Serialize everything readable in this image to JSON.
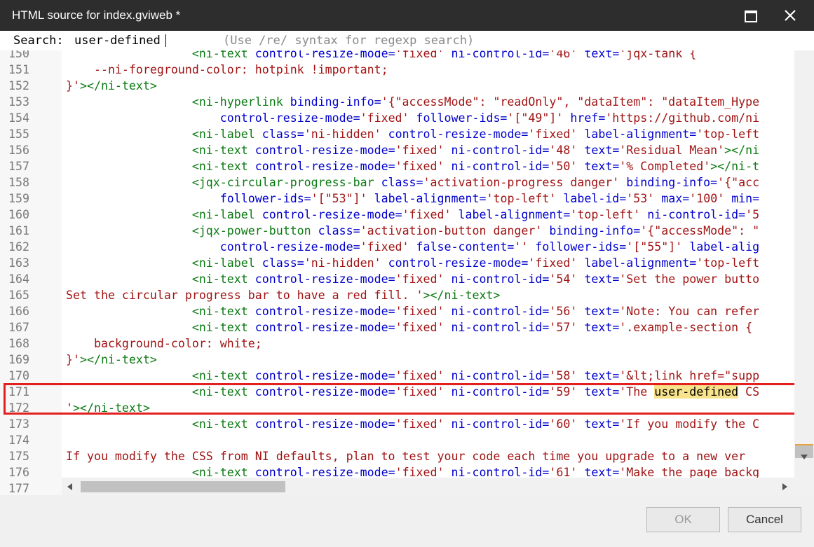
{
  "window": {
    "title": "HTML source for index.gviweb *"
  },
  "search": {
    "label": "Search:",
    "value": "user-defined",
    "hint": "(Use /re/ syntax for regexp search)"
  },
  "editor": {
    "lines": [
      {
        "num": "150",
        "segments": [
          [
            "",
            "                  "
          ],
          [
            "t",
            "<ni-text"
          ],
          [
            "",
            " "
          ],
          [
            "a",
            "control-resize-mode="
          ],
          [
            "v",
            "'fixed'"
          ],
          [
            "",
            " "
          ],
          [
            "a",
            "ni-control-id="
          ],
          [
            "v",
            "'46'"
          ],
          [
            "",
            " "
          ],
          [
            "a",
            "text="
          ],
          [
            "v",
            "'jqx-tank {"
          ]
        ]
      },
      {
        "num": "151",
        "segments": [
          [
            "v",
            "    --ni-foreground-color: hotpink !important;"
          ]
        ]
      },
      {
        "num": "152",
        "segments": [
          [
            "v",
            "}'"
          ],
          [
            "t",
            "></ni-text>"
          ]
        ]
      },
      {
        "num": "153",
        "segments": [
          [
            "",
            "                  "
          ],
          [
            "t",
            "<ni-hyperlink"
          ],
          [
            "",
            " "
          ],
          [
            "a",
            "binding-info="
          ],
          [
            "v",
            "'{\"accessMode\": \"readOnly\", \"dataItem\": \"dataItem_Hype"
          ]
        ]
      },
      {
        "num": "154",
        "segments": [
          [
            "",
            "                      "
          ],
          [
            "a",
            "control-resize-mode="
          ],
          [
            "v",
            "'fixed'"
          ],
          [
            "",
            " "
          ],
          [
            "a",
            "follower-ids="
          ],
          [
            "v",
            "'[\"49\"]'"
          ],
          [
            "",
            " "
          ],
          [
            "a",
            "href="
          ],
          [
            "v",
            "'https://github.com/ni"
          ]
        ]
      },
      {
        "num": "155",
        "segments": [
          [
            "",
            "                  "
          ],
          [
            "t",
            "<ni-label"
          ],
          [
            "",
            " "
          ],
          [
            "a",
            "class="
          ],
          [
            "v",
            "'ni-hidden'"
          ],
          [
            "",
            " "
          ],
          [
            "a",
            "control-resize-mode="
          ],
          [
            "v",
            "'fixed'"
          ],
          [
            "",
            " "
          ],
          [
            "a",
            "label-alignment="
          ],
          [
            "v",
            "'top-left"
          ]
        ]
      },
      {
        "num": "156",
        "segments": [
          [
            "",
            "                  "
          ],
          [
            "t",
            "<ni-text"
          ],
          [
            "",
            " "
          ],
          [
            "a",
            "control-resize-mode="
          ],
          [
            "v",
            "'fixed'"
          ],
          [
            "",
            " "
          ],
          [
            "a",
            "ni-control-id="
          ],
          [
            "v",
            "'48'"
          ],
          [
            "",
            " "
          ],
          [
            "a",
            "text="
          ],
          [
            "v",
            "'Residual Mean'"
          ],
          [
            "t",
            "></ni"
          ]
        ]
      },
      {
        "num": "157",
        "segments": [
          [
            "",
            "                  "
          ],
          [
            "t",
            "<ni-text"
          ],
          [
            "",
            " "
          ],
          [
            "a",
            "control-resize-mode="
          ],
          [
            "v",
            "'fixed'"
          ],
          [
            "",
            " "
          ],
          [
            "a",
            "ni-control-id="
          ],
          [
            "v",
            "'50'"
          ],
          [
            "",
            " "
          ],
          [
            "a",
            "text="
          ],
          [
            "v",
            "'% Completed'"
          ],
          [
            "t",
            "></ni-t"
          ]
        ]
      },
      {
        "num": "158",
        "segments": [
          [
            "",
            "                  "
          ],
          [
            "t",
            "<jqx-circular-progress-bar"
          ],
          [
            "",
            " "
          ],
          [
            "a",
            "class="
          ],
          [
            "v",
            "'activation-progress danger'"
          ],
          [
            "",
            " "
          ],
          [
            "a",
            "binding-info="
          ],
          [
            "v",
            "'{\"acc"
          ]
        ]
      },
      {
        "num": "159",
        "segments": [
          [
            "",
            "                      "
          ],
          [
            "a",
            "follower-ids="
          ],
          [
            "v",
            "'[\"53\"]'"
          ],
          [
            "",
            " "
          ],
          [
            "a",
            "label-alignment="
          ],
          [
            "v",
            "'top-left'"
          ],
          [
            "",
            " "
          ],
          [
            "a",
            "label-id="
          ],
          [
            "v",
            "'53'"
          ],
          [
            "",
            " "
          ],
          [
            "a",
            "max="
          ],
          [
            "v",
            "'100'"
          ],
          [
            "",
            " "
          ],
          [
            "a",
            "min="
          ]
        ]
      },
      {
        "num": "160",
        "segments": [
          [
            "",
            "                  "
          ],
          [
            "t",
            "<ni-label"
          ],
          [
            "",
            " "
          ],
          [
            "a",
            "control-resize-mode="
          ],
          [
            "v",
            "'fixed'"
          ],
          [
            "",
            " "
          ],
          [
            "a",
            "label-alignment="
          ],
          [
            "v",
            "'top-left'"
          ],
          [
            "",
            " "
          ],
          [
            "a",
            "ni-control-id="
          ],
          [
            "v",
            "'5"
          ]
        ]
      },
      {
        "num": "161",
        "segments": [
          [
            "",
            "                  "
          ],
          [
            "t",
            "<jqx-power-button"
          ],
          [
            "",
            " "
          ],
          [
            "a",
            "class="
          ],
          [
            "v",
            "'activation-button danger'"
          ],
          [
            "",
            " "
          ],
          [
            "a",
            "binding-info="
          ],
          [
            "v",
            "'{\"accessMode\": \""
          ]
        ]
      },
      {
        "num": "162",
        "segments": [
          [
            "",
            "                      "
          ],
          [
            "a",
            "control-resize-mode="
          ],
          [
            "v",
            "'fixed'"
          ],
          [
            "",
            " "
          ],
          [
            "a",
            "false-content="
          ],
          [
            "v",
            "''"
          ],
          [
            "",
            " "
          ],
          [
            "a",
            "follower-ids="
          ],
          [
            "v",
            "'[\"55\"]'"
          ],
          [
            "",
            " "
          ],
          [
            "a",
            "label-alig"
          ]
        ]
      },
      {
        "num": "163",
        "segments": [
          [
            "",
            "                  "
          ],
          [
            "t",
            "<ni-label"
          ],
          [
            "",
            " "
          ],
          [
            "a",
            "class="
          ],
          [
            "v",
            "'ni-hidden'"
          ],
          [
            "",
            " "
          ],
          [
            "a",
            "control-resize-mode="
          ],
          [
            "v",
            "'fixed'"
          ],
          [
            "",
            " "
          ],
          [
            "a",
            "label-alignment="
          ],
          [
            "v",
            "'top-left"
          ]
        ]
      },
      {
        "num": "164",
        "segments": [
          [
            "",
            "                  "
          ],
          [
            "t",
            "<ni-text"
          ],
          [
            "",
            " "
          ],
          [
            "a",
            "control-resize-mode="
          ],
          [
            "v",
            "'fixed'"
          ],
          [
            "",
            " "
          ],
          [
            "a",
            "ni-control-id="
          ],
          [
            "v",
            "'54'"
          ],
          [
            "",
            " "
          ],
          [
            "a",
            "text="
          ],
          [
            "v",
            "'Set the power butto"
          ]
        ]
      },
      {
        "num": "165",
        "segments": [
          [
            "v",
            "Set the circular progress bar to have a red fill. '"
          ],
          [
            "t",
            "></ni-text>"
          ]
        ]
      },
      {
        "num": "166",
        "segments": [
          [
            "",
            "                  "
          ],
          [
            "t",
            "<ni-text"
          ],
          [
            "",
            " "
          ],
          [
            "a",
            "control-resize-mode="
          ],
          [
            "v",
            "'fixed'"
          ],
          [
            "",
            " "
          ],
          [
            "a",
            "ni-control-id="
          ],
          [
            "v",
            "'56'"
          ],
          [
            "",
            " "
          ],
          [
            "a",
            "text="
          ],
          [
            "v",
            "'Note: You can refer"
          ]
        ]
      },
      {
        "num": "167",
        "segments": [
          [
            "",
            "                  "
          ],
          [
            "t",
            "<ni-text"
          ],
          [
            "",
            " "
          ],
          [
            "a",
            "control-resize-mode="
          ],
          [
            "v",
            "'fixed'"
          ],
          [
            "",
            " "
          ],
          [
            "a",
            "ni-control-id="
          ],
          [
            "v",
            "'57'"
          ],
          [
            "",
            " "
          ],
          [
            "a",
            "text="
          ],
          [
            "v",
            "'.example-section {"
          ]
        ]
      },
      {
        "num": "168",
        "segments": [
          [
            "v",
            "    background-color: white;"
          ]
        ]
      },
      {
        "num": "169",
        "segments": [
          [
            "v",
            "}'"
          ],
          [
            "t",
            "></ni-text>"
          ]
        ]
      },
      {
        "num": "170",
        "segments": [
          [
            "",
            "                  "
          ],
          [
            "t",
            "<ni-text"
          ],
          [
            "",
            " "
          ],
          [
            "a",
            "control-resize-mode="
          ],
          [
            "v",
            "'fixed'"
          ],
          [
            "",
            " "
          ],
          [
            "a",
            "ni-control-id="
          ],
          [
            "v",
            "'58'"
          ],
          [
            "",
            " "
          ],
          [
            "a",
            "text="
          ],
          [
            "v",
            "'&lt;link href=\"supp"
          ]
        ]
      },
      {
        "num": "171",
        "segments": [
          [
            "",
            "                  "
          ],
          [
            "t",
            "<ni-text"
          ],
          [
            "",
            " "
          ],
          [
            "a",
            "control-resize-mode="
          ],
          [
            "v",
            "'fixed'"
          ],
          [
            "",
            " "
          ],
          [
            "a",
            "ni-control-id="
          ],
          [
            "v",
            "'59'"
          ],
          [
            "",
            " "
          ],
          [
            "a",
            "text="
          ],
          [
            "v",
            "'The "
          ],
          [
            "hl",
            "user-defined"
          ],
          [
            "v",
            " CS"
          ]
        ]
      },
      {
        "num": "172",
        "segments": [
          [
            "v",
            "'"
          ],
          [
            "t",
            "></ni-text>"
          ]
        ]
      },
      {
        "num": "173",
        "segments": [
          [
            "",
            "                  "
          ],
          [
            "t",
            "<ni-text"
          ],
          [
            "",
            " "
          ],
          [
            "a",
            "control-resize-mode="
          ],
          [
            "v",
            "'fixed'"
          ],
          [
            "",
            " "
          ],
          [
            "a",
            "ni-control-id="
          ],
          [
            "v",
            "'60'"
          ],
          [
            "",
            " "
          ],
          [
            "a",
            "text="
          ],
          [
            "v",
            "'If you modify the C"
          ]
        ]
      },
      {
        "num": "174",
        "segments": []
      },
      {
        "num": "175",
        "segments": [
          [
            "v",
            "If you modify the CSS from NI defaults, plan to test your code each time you upgrade to a new ver"
          ]
        ]
      },
      {
        "num": "176",
        "segments": [
          [
            "",
            "                  "
          ],
          [
            "t",
            "<ni-text"
          ],
          [
            "",
            " "
          ],
          [
            "a",
            "control-resize-mode="
          ],
          [
            "v",
            "'fixed'"
          ],
          [
            "",
            " "
          ],
          [
            "a",
            "ni-control-id="
          ],
          [
            "v",
            "'61'"
          ],
          [
            "",
            " "
          ],
          [
            "a",
            "text="
          ],
          [
            "v",
            "'Make the page backg"
          ]
        ]
      },
      {
        "num": "177",
        "segments": []
      }
    ]
  },
  "footer": {
    "ok_label": "OK",
    "cancel_label": "Cancel"
  },
  "colors": {
    "tag": "#0b7a12",
    "attribute": "#0000cc",
    "value": "#a11414",
    "match_highlight": "#f8e38a",
    "annotation": "#e32020",
    "titlebar": "#2d2d2d"
  },
  "icons": {
    "maximize": "maximize-icon",
    "close": "close-icon",
    "scroll_left": "arrow-left-icon",
    "scroll_right": "arrow-right-icon",
    "scroll_down": "arrow-down-icon"
  }
}
